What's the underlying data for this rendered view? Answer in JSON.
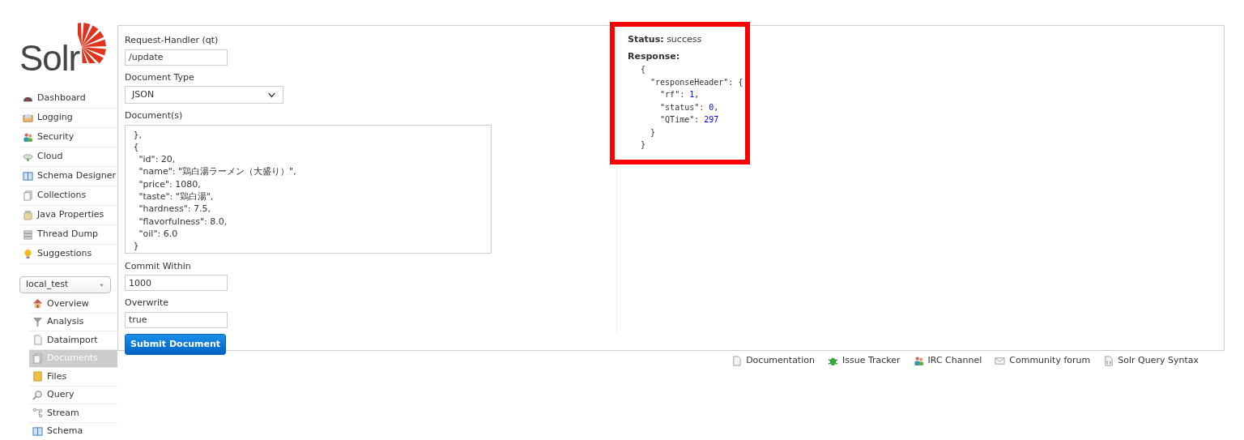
{
  "logo": {
    "text": "Solr"
  },
  "sidebar": {
    "items": [
      {
        "label": "Dashboard",
        "selected": false
      },
      {
        "label": "Logging",
        "selected": false
      },
      {
        "label": "Security",
        "selected": false
      },
      {
        "label": "Cloud",
        "selected": false
      },
      {
        "label": "Schema Designer",
        "selected": false
      },
      {
        "label": "Collections",
        "selected": false
      },
      {
        "label": "Java Properties",
        "selected": false
      },
      {
        "label": "Thread Dump",
        "selected": false
      },
      {
        "label": "Suggestions",
        "selected": false
      }
    ]
  },
  "core_selector": {
    "value": "local_test"
  },
  "core_menu": [
    {
      "label": "Overview",
      "selected": false
    },
    {
      "label": "Analysis",
      "selected": false
    },
    {
      "label": "Dataimport",
      "selected": false
    },
    {
      "label": "Documents",
      "selected": true
    },
    {
      "label": "Files",
      "selected": false
    },
    {
      "label": "Query",
      "selected": false
    },
    {
      "label": "Stream",
      "selected": false
    },
    {
      "label": "Schema",
      "selected": false
    }
  ],
  "form": {
    "request_handler": {
      "label": "Request-Handler (qt)",
      "value": "/update"
    },
    "document_type": {
      "label": "Document Type",
      "value": "JSON"
    },
    "documents": {
      "label": "Document(s)",
      "value": " },\n {\n   \"id\": 20,\n   \"name\": \"鶏白湯ラーメン（大盛り）\",\n   \"price\": 1080,\n   \"taste\": \"鶏白湯\",\n   \"hardness\": 7.5,\n   \"flavorfulness\": 8.0,\n   \"oil\": 6.0\n }"
    },
    "commit_within": {
      "label": "Commit Within",
      "value": "1000"
    },
    "overwrite": {
      "label": "Overwrite",
      "value": "true"
    },
    "submit": "Submit Document"
  },
  "result": {
    "status_label": "Status:",
    "status": "success",
    "response_label": "Response:",
    "lines": [
      {
        "text": "{"
      },
      {
        "text": "  \"responseHeader\": {"
      },
      {
        "text": "    \"rf\": ",
        "number": "1",
        "after": ","
      },
      {
        "text": "    \"status\": ",
        "number": "0",
        "after": ","
      },
      {
        "text": "    \"QTime\": ",
        "number": "297"
      },
      {
        "text": "  }"
      },
      {
        "text": "}"
      }
    ]
  },
  "footer_links": [
    "Documentation",
    "Issue Tracker",
    "IRC Channel",
    "Community forum",
    "Solr Query Syntax"
  ]
}
